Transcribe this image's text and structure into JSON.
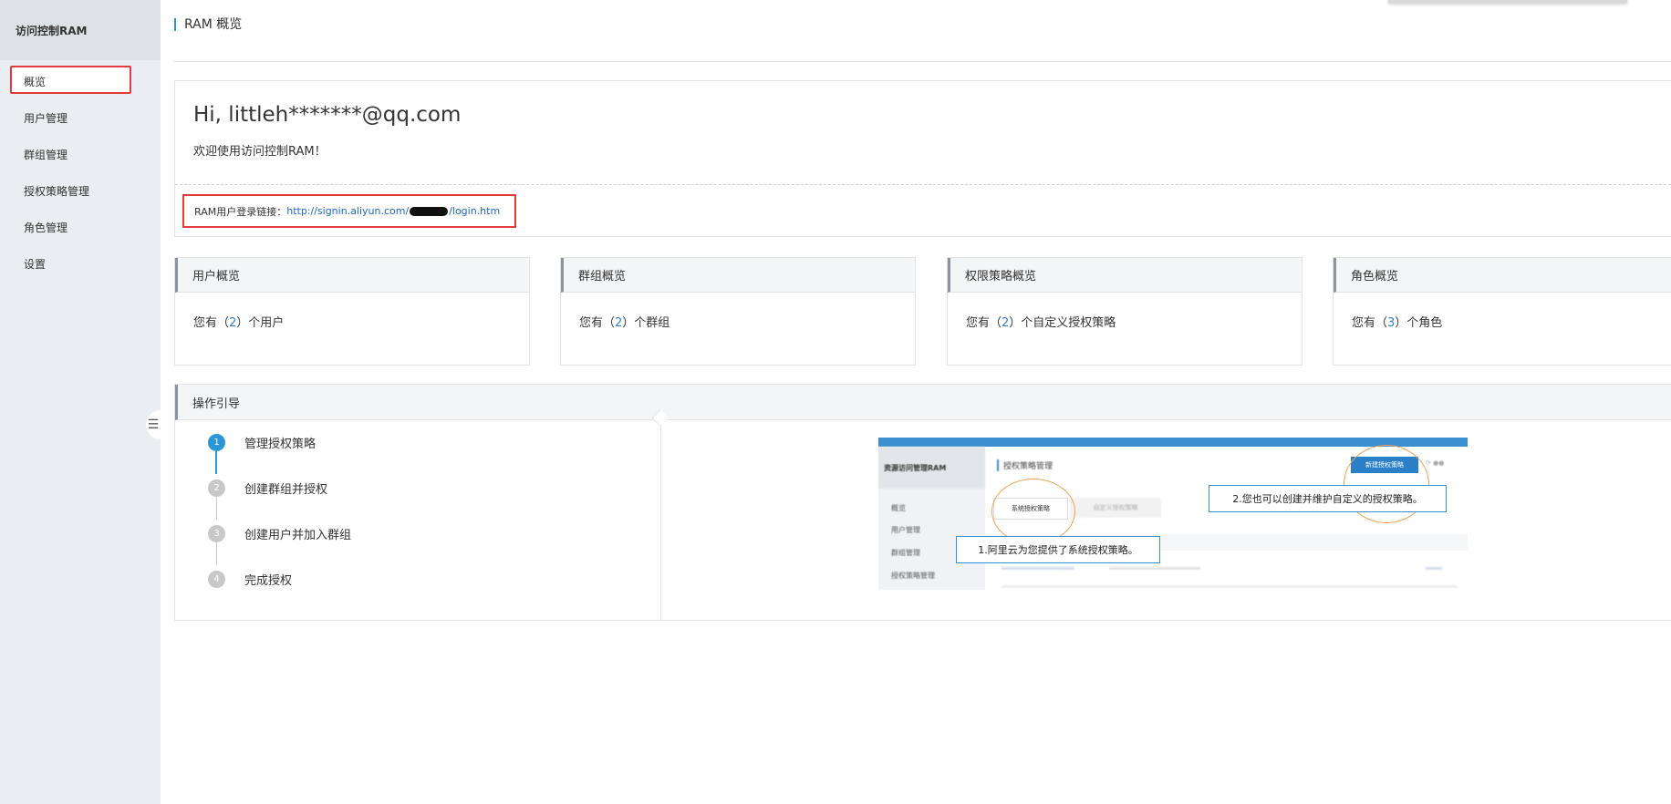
{
  "sidebar": {
    "title": "访问控制RAM",
    "items": [
      {
        "label": "概览"
      },
      {
        "label": "用户管理"
      },
      {
        "label": "群组管理"
      },
      {
        "label": "授权策略管理"
      },
      {
        "label": "角色管理"
      },
      {
        "label": "设置"
      }
    ],
    "collapse_icon": "menu-collapse-icon"
  },
  "page": {
    "title": "RAM 概览"
  },
  "welcome": {
    "greeting": "Hi, littleh*******@qq.com",
    "subtitle": "欢迎使用访问控制RAM！",
    "login_label": "RAM用户登录链接：",
    "login_link_prefix": "http://signin.aliyun.com/",
    "login_link_suffix": "/login.htm"
  },
  "cards": [
    {
      "title": "用户概览",
      "prefix": "您有（",
      "count": "2",
      "suffix": "）个用户"
    },
    {
      "title": "群组概览",
      "prefix": "您有（",
      "count": "2",
      "suffix": "）个群组"
    },
    {
      "title": "权限策略概览",
      "prefix": "您有（",
      "count": "2",
      "suffix": "）个自定义授权策略"
    },
    {
      "title": "角色概览",
      "prefix": "您有（",
      "count": "3",
      "suffix": "）个角色"
    }
  ],
  "guide": {
    "title": "操作引导",
    "steps": [
      {
        "num": "1",
        "label": "管理授权策略"
      },
      {
        "num": "2",
        "label": "创建群组并授权"
      },
      {
        "num": "3",
        "label": "创建用户并加入群组"
      },
      {
        "num": "4",
        "label": "完成授权"
      }
    ],
    "preview": {
      "sidebar_title": "资源访问管理RAM",
      "sidebar_items": [
        "概览",
        "用户管理",
        "群组管理",
        "授权策略管理"
      ],
      "page_title": "授权策略管理",
      "new_button": "新建授权策略",
      "tab_system": "系统授权策略",
      "tab_custom": "自定义授权策略",
      "callout1": "1.阿里云为您提供了系统授权策略。",
      "callout2": "2.您也可以创建并维护自定义的授权策略。"
    }
  },
  "colors": {
    "accent": "#2b96d6",
    "highlight_border": "#e23b3b",
    "link": "#1a68c6"
  }
}
